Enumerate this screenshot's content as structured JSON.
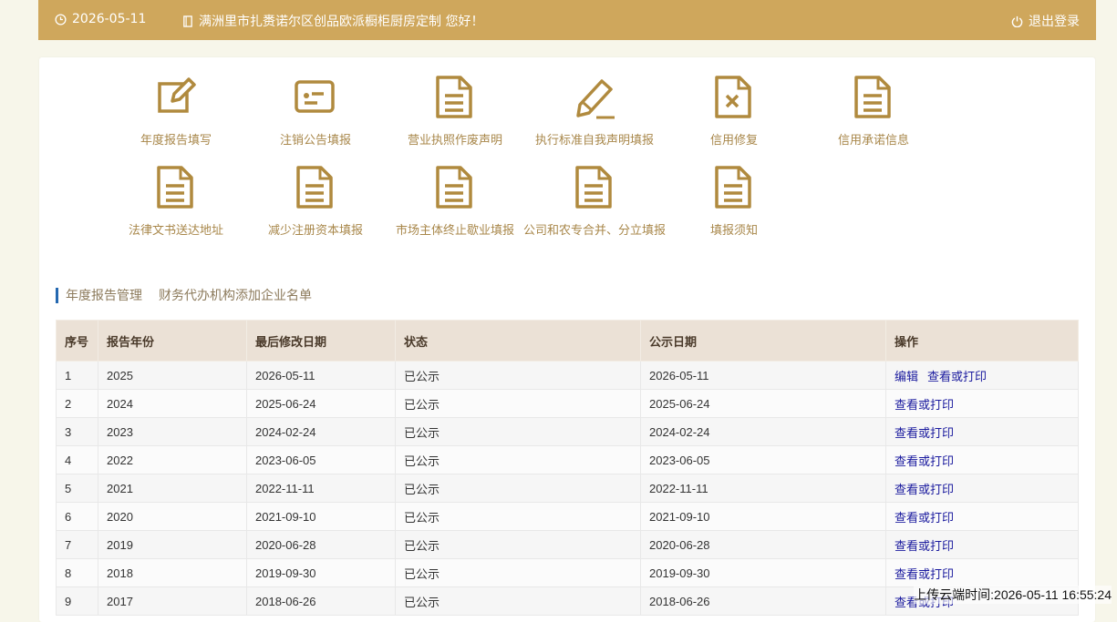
{
  "header": {
    "date": "2026-05-11",
    "greeting": "满洲里市扎赉诺尔区创品欧派橱柜厨房定制 您好！",
    "logout": "退出登录"
  },
  "colors": {
    "accent": "#cfa75c",
    "icon": "#b08a3e",
    "link": "#1a1a9e",
    "tab_bar": "#2468b0"
  },
  "menu": [
    {
      "label": "年度报告填写",
      "icon": "edit-icon"
    },
    {
      "label": "注销公告填报",
      "icon": "id-card-icon"
    },
    {
      "label": "营业执照作废声明",
      "icon": "document-icon"
    },
    {
      "label": "执行标准自我声明填报",
      "icon": "pencil-icon"
    },
    {
      "label": "信用修复",
      "icon": "file-x-icon"
    },
    {
      "label": "信用承诺信息",
      "icon": "document-icon"
    },
    {
      "label": "法律文书送达地址",
      "icon": "document-icon"
    },
    {
      "label": "减少注册资本填报",
      "icon": "document-icon"
    },
    {
      "label": "市场主体终止歇业填报",
      "icon": "document-icon"
    },
    {
      "label": "公司和农专合并、分立填报",
      "icon": "document-icon"
    },
    {
      "label": "填报须知",
      "icon": "document-icon"
    }
  ],
  "tabs": [
    "年度报告管理",
    "财务代办机构添加企业名单"
  ],
  "table": {
    "columns": [
      "序号",
      "报告年份",
      "最后修改日期",
      "状态",
      "公示日期",
      "操作"
    ],
    "rows": [
      {
        "no": "1",
        "year": "2025",
        "modified": "2026-05-11",
        "status": "已公示",
        "published": "2026-05-11",
        "actions": [
          "编辑",
          "查看或打印"
        ]
      },
      {
        "no": "2",
        "year": "2024",
        "modified": "2025-06-24",
        "status": "已公示",
        "published": "2025-06-24",
        "actions": [
          "查看或打印"
        ]
      },
      {
        "no": "3",
        "year": "2023",
        "modified": "2024-02-24",
        "status": "已公示",
        "published": "2024-02-24",
        "actions": [
          "查看或打印"
        ]
      },
      {
        "no": "4",
        "year": "2022",
        "modified": "2023-06-05",
        "status": "已公示",
        "published": "2023-06-05",
        "actions": [
          "查看或打印"
        ]
      },
      {
        "no": "5",
        "year": "2021",
        "modified": "2022-11-11",
        "status": "已公示",
        "published": "2022-11-11",
        "actions": [
          "查看或打印"
        ]
      },
      {
        "no": "6",
        "year": "2020",
        "modified": "2021-09-10",
        "status": "已公示",
        "published": "2021-09-10",
        "actions": [
          "查看或打印"
        ]
      },
      {
        "no": "7",
        "year": "2019",
        "modified": "2020-06-28",
        "status": "已公示",
        "published": "2020-06-28",
        "actions": [
          "查看或打印"
        ]
      },
      {
        "no": "8",
        "year": "2018",
        "modified": "2019-09-30",
        "status": "已公示",
        "published": "2019-09-30",
        "actions": [
          "查看或打印"
        ]
      },
      {
        "no": "9",
        "year": "2017",
        "modified": "2018-06-26",
        "status": "已公示",
        "published": "2018-06-26",
        "actions": [
          "查看或打印"
        ]
      }
    ]
  },
  "footer": "上传云端时间:2026-05-11 16:55:24"
}
